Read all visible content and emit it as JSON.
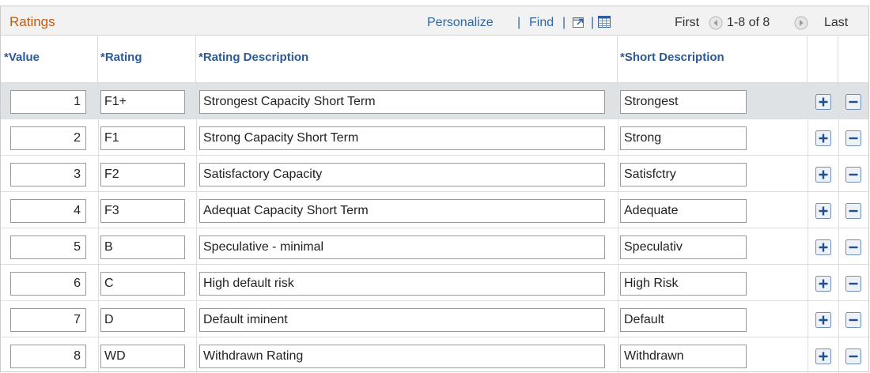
{
  "grid": {
    "title": "Ratings",
    "personalize_label": "Personalize",
    "find_label": "Find",
    "separator": "|",
    "first_label": "First",
    "range_label": "1-8 of 8",
    "last_label": "Last"
  },
  "columns": {
    "value": "*Value",
    "rating": "*Rating",
    "description": "*Rating Description",
    "short_description": "*Short Description"
  },
  "rows": [
    {
      "value": "1",
      "rating": "F1+",
      "description": "Strongest Capacity Short Term",
      "short_description": "Strongest"
    },
    {
      "value": "2",
      "rating": "F1",
      "description": "Strong Capacity Short Term",
      "short_description": "Strong"
    },
    {
      "value": "3",
      "rating": "F2",
      "description": "Satisfactory Capacity",
      "short_description": "Satisfctry"
    },
    {
      "value": "4",
      "rating": "F3",
      "description": "Adequat Capacity Short Term",
      "short_description": "Adequate"
    },
    {
      "value": "5",
      "rating": "B",
      "description": "Speculative - minimal",
      "short_description": "Speculativ"
    },
    {
      "value": "6",
      "rating": "C",
      "description": "High default risk",
      "short_description": "High Risk"
    },
    {
      "value": "7",
      "rating": "D",
      "description": "Default iminent",
      "short_description": "Default"
    },
    {
      "value": "8",
      "rating": "WD",
      "description": "Withdrawn Rating",
      "short_description": "Withdrawn"
    }
  ],
  "colors": {
    "title": "#c25b10",
    "link": "#2c67a5",
    "header_text": "#2c5a97",
    "selected_row": "#dee2e4"
  },
  "icons": {
    "zoom": "new-window-icon",
    "download": "spreadsheet-icon",
    "prev": "arrow-left-icon",
    "next": "arrow-right-icon",
    "add_row": "plus-icon",
    "delete_row": "minus-icon"
  }
}
